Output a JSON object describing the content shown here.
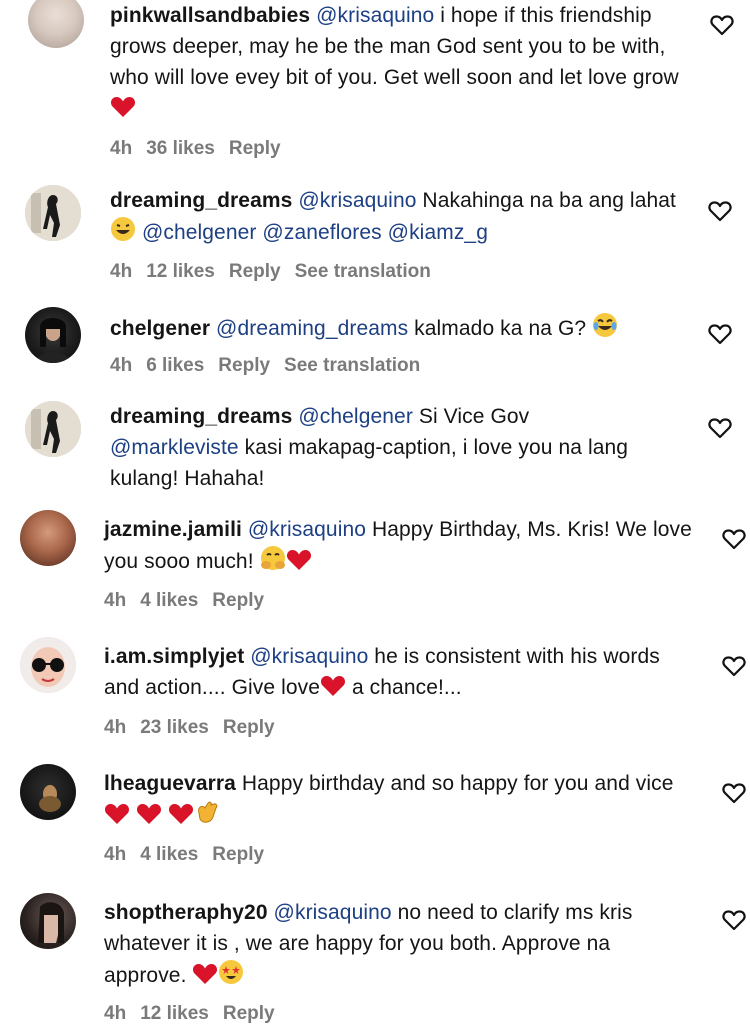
{
  "comments": [
    {
      "username": "pinkwallsandbabies",
      "mention": "@krisaquino",
      "text": " i hope if this friendship grows deeper, may he be the man God sent you to be with, who will love evey bit of you. Get well soon and let love grow",
      "time": "4h",
      "likes": "36 likes",
      "reply": "Reply",
      "translation": ""
    },
    {
      "username": "dreaming_dreams",
      "mention": "@krisaquino",
      "text": " Nakahinga na ba ang lahat",
      "mention2": "@chelgener @zaneflores @kiamz_g",
      "time": "4h",
      "likes": "12 likes",
      "reply": "Reply",
      "translation": "See translation"
    },
    {
      "username": "chelgener",
      "mention": "@dreaming_dreams",
      "text": " kalmado ka na G?",
      "time": "4h",
      "likes": "6 likes",
      "reply": "Reply",
      "translation": "See translation"
    },
    {
      "username": "dreaming_dreams",
      "mention": "@chelgener",
      "text": " Si Vice Gov",
      "mention2": "@markleviste",
      "text2": " kasi makapag-caption, i love you na lang kulang! Hahaha!",
      "time": "",
      "likes": "",
      "reply": "",
      "translation": ""
    },
    {
      "username": "jazmine.jamili",
      "mention": "@krisaquino",
      "text": " Happy Birthday, Ms. Kris! We love you sooo much!",
      "time": "4h",
      "likes": "4 likes",
      "reply": "Reply",
      "translation": ""
    },
    {
      "username": "i.am.simplyjet",
      "mention": "@krisaquino",
      "text": " he is consistent with his words and action.... Give love",
      "text2": " a chance!...",
      "time": "4h",
      "likes": "23 likes",
      "reply": "Reply",
      "translation": ""
    },
    {
      "username": "lheaguevarra",
      "mention": "",
      "text": " Happy birthday and so happy for you and vice",
      "time": "4h",
      "likes": "4 likes",
      "reply": "Reply",
      "translation": ""
    },
    {
      "username": "shoptheraphy20",
      "mention": "@krisaquino",
      "text": " no need to clarify ms kris whatever it is , we are happy for you both. Approve na approve.",
      "time": "4h",
      "likes": "12 likes",
      "reply": "Reply",
      "translation": ""
    }
  ],
  "icons": {
    "like": "heart-outline-icon"
  },
  "colors": {
    "mention": "#1d3f83",
    "meta": "#7a7a7a",
    "red_heart": "#d9142a"
  }
}
